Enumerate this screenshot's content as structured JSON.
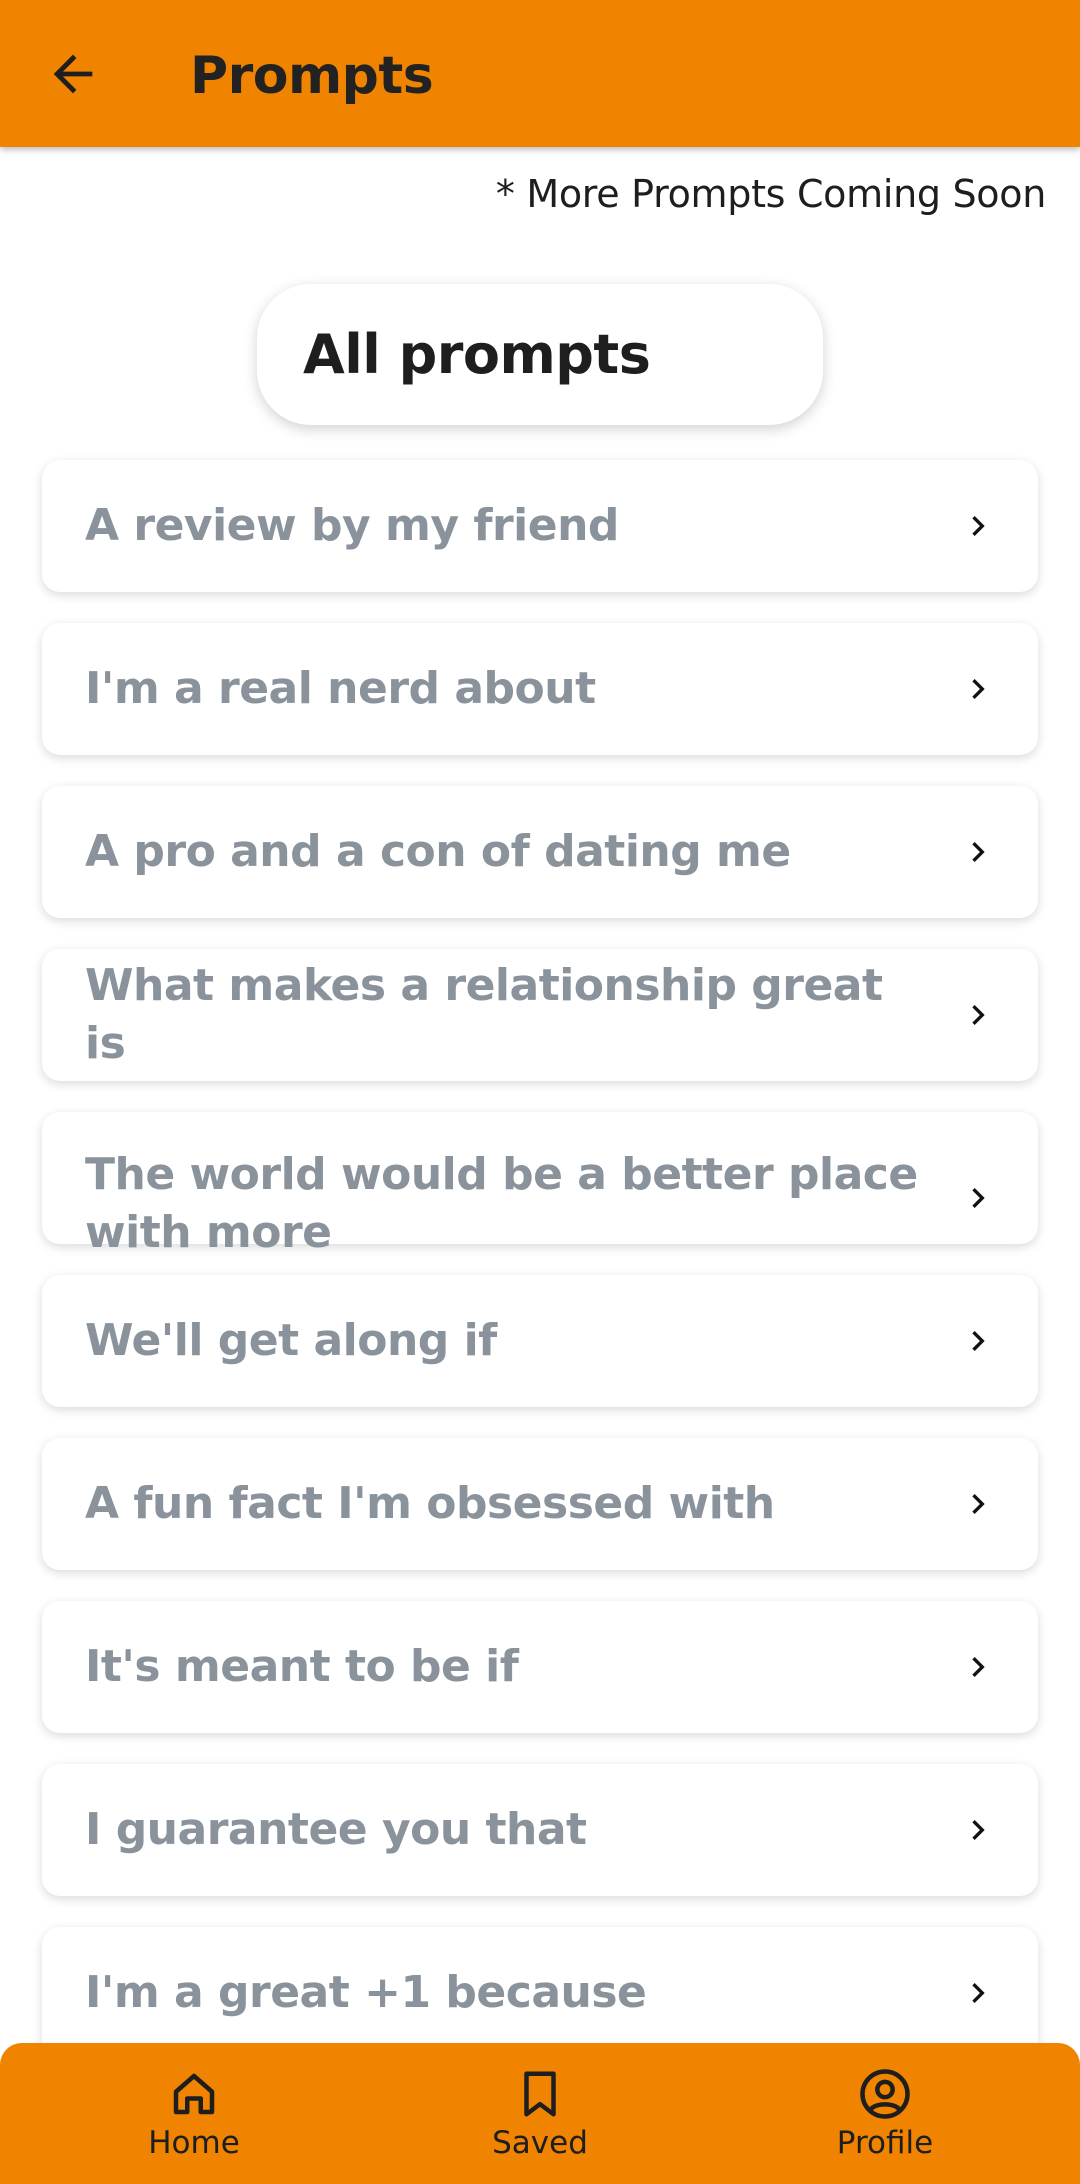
{
  "appbar": {
    "title": "Prompts",
    "back_icon": "arrow-left-icon"
  },
  "notice": "* More Prompts Coming Soon",
  "section_chip": "All prompts",
  "prompts": [
    "A review by my friend",
    "I'm a real nerd about",
    "A pro and a con of dating me",
    "What makes a relationship great is",
    "The world would be a better place with more",
    "We'll get along if",
    "A fun fact I'm obsessed with",
    "It's meant to be if",
    "I guarantee you that",
    "I'm a great +1 because"
  ],
  "bottom_nav": {
    "items": [
      {
        "label": "Home",
        "icon": "home-icon"
      },
      {
        "label": "Saved",
        "icon": "bookmark-icon"
      },
      {
        "label": "Profile",
        "icon": "profile-icon"
      }
    ]
  },
  "colors": {
    "accent": "#f08400",
    "prompt_text": "#8a939b",
    "title_text": "#222222",
    "background": "#ffffff"
  }
}
